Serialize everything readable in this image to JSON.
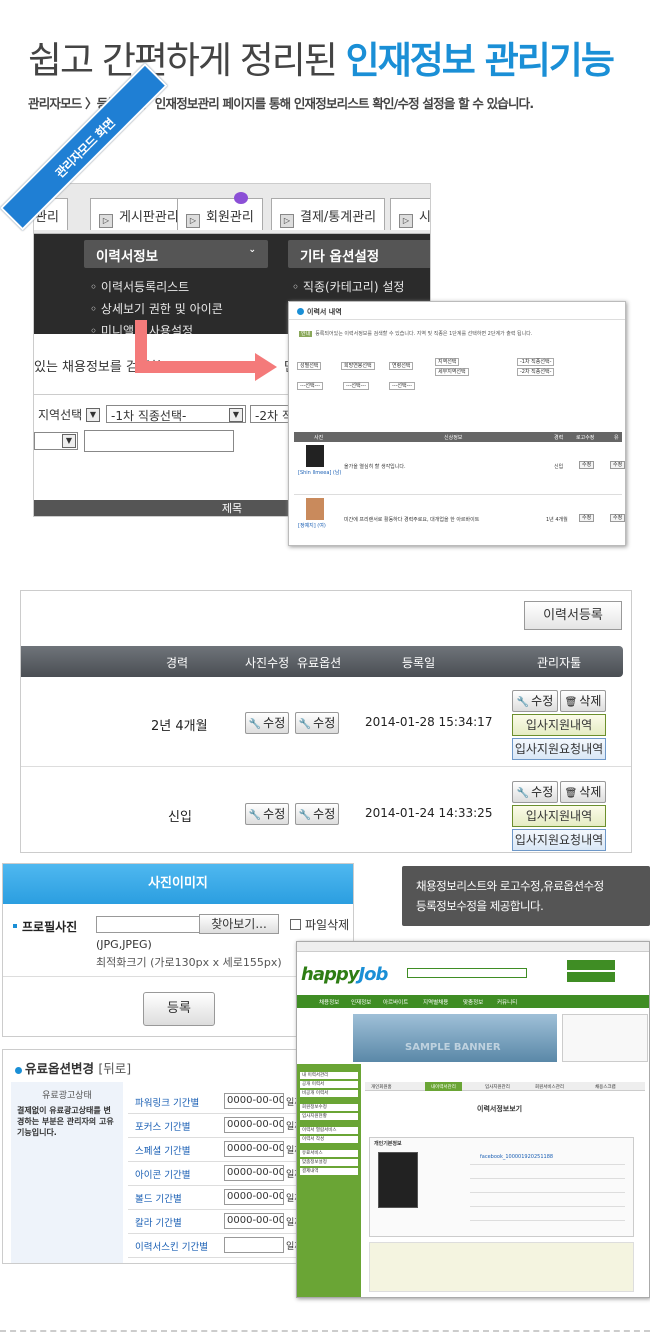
{
  "header": {
    "title_prefix": "쉽고 간편하게 정리된 ",
    "title_highlight": "인재정보 관리기능",
    "subtitle": "관리자모드 〉등록관리 〉인재정보관리 페이지를 통해 인재정보리스트 확인/수정 설정을 할 수 있습니다."
  },
  "ribbon": "관리자모드 화면",
  "admin": {
    "tabs": [
      "관리",
      "게시판관리",
      "회원관리",
      "결제/통계관리",
      "시"
    ],
    "menu_left": "이력서정보",
    "menu_right": "기타 옵션설정",
    "items_left": [
      "이력서등록리스트",
      "상세보기 권한 및 아이콘",
      "미니앨범 사용설정"
    ],
    "items_right": [
      "직종(카테고리) 설정"
    ],
    "search_text": "있는 채용정보를 검색할",
    "search_text2": "단계",
    "select1": "지역선택",
    "select2": "-1차 직종선택-",
    "select3": "-2차 직",
    "footer_col": "제목"
  },
  "resume": {
    "title": "이력서 내역",
    "desc": "등록되어있는 이력서정보를 검색할 수 있습니다. 지역 및 직종은 1단계를 선택하면 2단계가 출력 됩니다.",
    "selects": [
      "성별선택",
      "희망연봉선택",
      "연령선택",
      "지역선택",
      "세부지역선택",
      "-1차 직종선택-",
      "-2차 직종선택-",
      "---선택---",
      "---선택---",
      "---선택---"
    ],
    "head": [
      "사진",
      "신상정보",
      "경력",
      "로고수정",
      "유"
    ],
    "rows": [
      {
        "name": "[Shin Ilmeea] (남)",
        "text": "올가을 열심히 할 생각입니다.",
        "career": "신입",
        "btn": "수정"
      },
      {
        "name": "[정예지] (여)",
        "text": "미간에 프리랜서로 활동하다 경력주로요, 대개업을 한 아르바이트",
        "career": "1년 4개월",
        "btn": "수정"
      }
    ]
  },
  "list": {
    "register_button": "이력서등록",
    "headers": {
      "career": "경력",
      "photo_edit": "사진수정",
      "paid_option": "유료옵션",
      "reg_date": "등록일",
      "admin_tools": "관리자툴"
    },
    "rows": [
      {
        "career": "2년 4개월",
        "edit1": "수정",
        "edit2": "수정",
        "date": "2014-01-28 15:34:17",
        "edit": "수정",
        "delete": "삭제",
        "apply": "입사지원내역",
        "request": "입사지원요청내역"
      },
      {
        "career": "신입",
        "edit1": "수정",
        "edit2": "수정",
        "date": "2014-01-24 14:33:25",
        "edit": "수정",
        "delete": "삭제",
        "apply": "입사지원내역",
        "request": "입사지원요청내역"
      }
    ]
  },
  "photo": {
    "header": "사진이미지",
    "label": "프로필사진",
    "find_button": "찾아보기...",
    "delete_label": "파일삭제",
    "formats": "(JPG,JPEG)",
    "size_hint": "최적화크기 (가로130px x 세로155px)",
    "register_button": "등록"
  },
  "note": {
    "line1": "채용정보리스트와 로고수정,유료옵션수정",
    "line2": "등록정보수정을 제공합니다."
  },
  "options": {
    "title": "유료옵션변경",
    "back": "[뒤로]",
    "left_title": "유료광고상태",
    "left_desc": "결제없이 유료광고상태를 변경하는 부분은 관리자의 고유기능입니다.",
    "rows": [
      {
        "label": "파워링크 기간별",
        "value": "0000-00-00",
        "suffix": "일까"
      },
      {
        "label": "포커스 기간별",
        "value": "0000-00-00",
        "suffix": "일까"
      },
      {
        "label": "스페셜 기간별",
        "value": "0000-00-00",
        "suffix": "일까"
      },
      {
        "label": "아이콘 기간별",
        "value": "0000-00-00",
        "suffix": "일까"
      },
      {
        "label": "볼드 기간별",
        "value": "0000-00-00",
        "suffix": "일까"
      },
      {
        "label": "칼라 기간별",
        "value": "0000-00-00",
        "suffix": "일까"
      },
      {
        "label": "이력서스킨 기간별",
        "value": "",
        "suffix": "일까"
      }
    ]
  },
  "site": {
    "logo_a": "happy",
    "logo_b": "Job",
    "nav": [
      "채용정보",
      "인재정보",
      "아르바이트",
      "지역별채용",
      "맞춤정보",
      "커뮤니티"
    ],
    "watermark": "SAMPLE BANNER",
    "page_title": "이력서정보보기",
    "side_items": [
      "내 이력서관리",
      "공개 이력서",
      "비공개 이력서",
      "회원정보수정",
      "입사지원현황",
      "이력서 열람서비스",
      "이력서 작성",
      "유료서비스",
      "맞춤정보설정",
      "결제내역"
    ],
    "name": "facebook_100001920251188",
    "tabs": [
      "개인회원홈",
      "내이력서관리",
      "입사지원관리",
      "회원서비스관리",
      "채용스크랩"
    ],
    "subsection": "개인기본정보"
  },
  "colors": {
    "accent": "#1a8fd6",
    "arrow": "#f47a7a",
    "menu": "#2b2b2b",
    "green": "#3f8d24"
  }
}
